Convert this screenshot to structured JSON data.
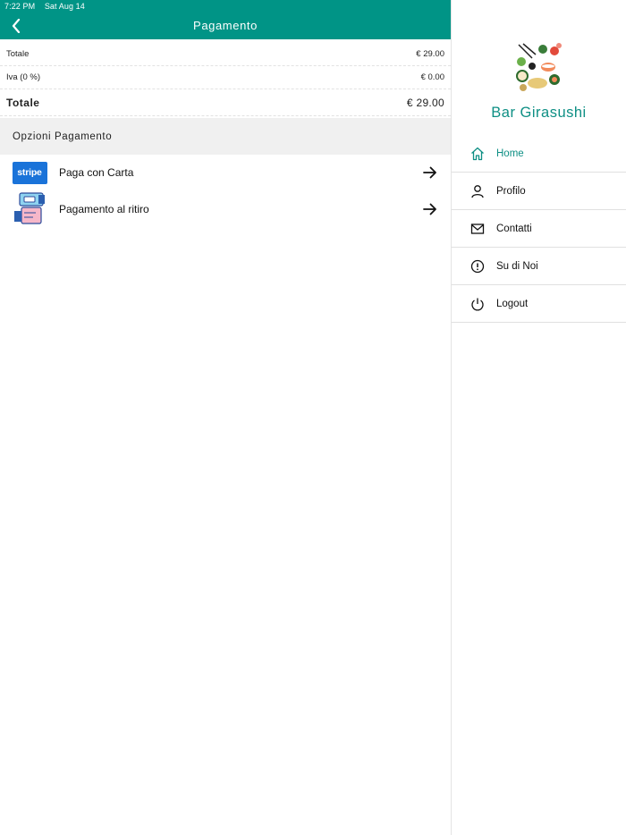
{
  "status_bar": {
    "time": "7:22 PM",
    "date": "Sat Aug 14"
  },
  "header": {
    "title": "Pagamento",
    "back_icon": "chevron-left-icon"
  },
  "summary": {
    "rows": [
      {
        "label": "Totale",
        "value": "€ 29.00"
      },
      {
        "label": "Iva (0 %)",
        "value": "€ 0.00"
      }
    ],
    "total": {
      "label": "Totale",
      "value": "€ 29.00"
    }
  },
  "payment_options": {
    "section_title": "Opzioni Pagamento",
    "items": [
      {
        "label": "Paga con Carta",
        "logo_text": "stripe",
        "icon": "stripe-logo"
      },
      {
        "label": "Pagamento al ritiro",
        "icon": "hands-payment-icon"
      }
    ]
  },
  "drawer": {
    "brand_name": "Bar Girasushi",
    "items": [
      {
        "label": "Home",
        "icon": "home-icon",
        "active": true
      },
      {
        "label": "Profilo",
        "icon": "user-icon",
        "active": false
      },
      {
        "label": "Contatti",
        "icon": "mail-icon",
        "active": false
      },
      {
        "label": "Su di Noi",
        "icon": "info-icon",
        "active": false
      },
      {
        "label": "Logout",
        "icon": "power-icon",
        "active": false
      }
    ]
  },
  "colors": {
    "accent": "#009486",
    "brand_text": "#0e8f84",
    "stripe": "#1a73d9"
  }
}
